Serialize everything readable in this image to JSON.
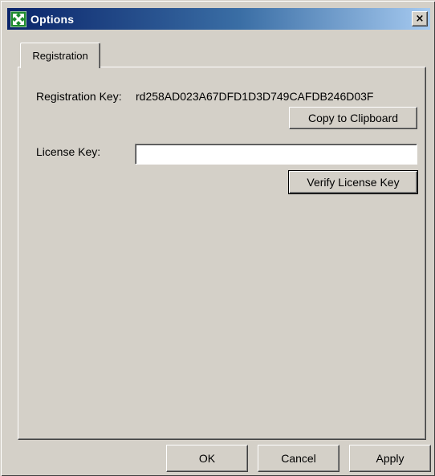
{
  "window": {
    "title": "Options",
    "close_glyph": "×"
  },
  "tabs": [
    {
      "label": "Registration",
      "selected": true
    }
  ],
  "registration": {
    "registration_key_label": "Registration Key:",
    "registration_key_value": "rd258AD023A67DFD1D3D749CAFDB246D03F",
    "copy_button_label": "Copy to Clipboard",
    "license_key_label": "License Key:",
    "license_key_value": "",
    "verify_button_label": "Verify License Key"
  },
  "footer": {
    "ok_label": "OK",
    "cancel_label": "Cancel",
    "apply_label": "Apply"
  },
  "colors": {
    "face": "#d4d0c8",
    "title_active": "#0a246a",
    "title_gradient_end": "#a6caf0"
  },
  "icons": {
    "title": "app-icon",
    "close": "close-icon"
  }
}
